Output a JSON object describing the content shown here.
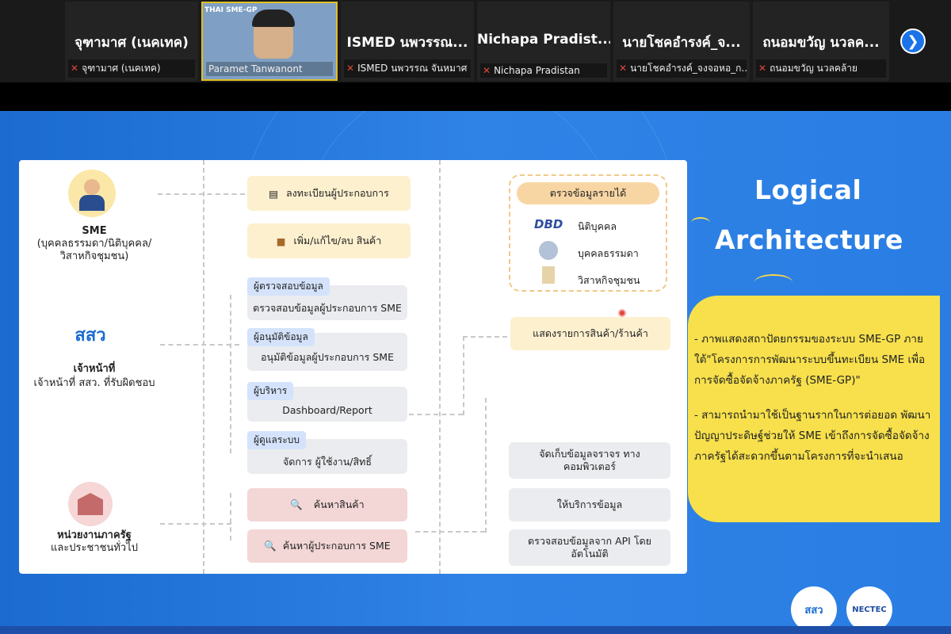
{
  "participants": [
    {
      "big": "จุฑามาศ (เนคเทค)",
      "small": "จุฑามาศ (เนคเทค)",
      "muted": true
    },
    {
      "big": "",
      "small": "Paramet Tanwanont",
      "muted": false,
      "video": true,
      "video_logo": "THAI SME-GP"
    },
    {
      "big": "ISMED นพวรรณ...",
      "small": "ISMED นพวรรณ จันหมาศ",
      "muted": true
    },
    {
      "big": "Nichapa  Pradist...",
      "small": "Nichapa Pradistan",
      "muted": true
    },
    {
      "big": "นายโชคอำรงค์_จ...",
      "small": "นายโชคอำรงค์_จงจอหอ_ก...",
      "muted": true
    },
    {
      "big": "ถนอมขวัญ นวลค...",
      "small": "ถนอมขวัญ นวลคล้าย",
      "muted": true
    }
  ],
  "next_label": "❯",
  "slide": {
    "title_line1": "Logical",
    "title_line2": "Architecture",
    "actors": {
      "sme_title": "SME",
      "sme_sub": "(บุคคลธรรมดา/นิติบุคคล/ วิสาหกิจชุมชน)",
      "staff_logo": "สสว",
      "staff_title": "เจ้าหน้าที่",
      "staff_sub": "เจ้าหน้าที่ สสว. ที่รับผิดชอบ",
      "gov_title": "หน่วยงานภาครัฐ",
      "gov_sub": "และประชาชนทั่วไป"
    },
    "boxes": {
      "register": "ลงทะเบียนผู้ประกอบการ",
      "products": "เพิ่ม/แก้ไข/ลบ สินค้า",
      "verifier_tag": "ผู้ตรวจสอบข้อมูล",
      "verifier": "ตรวจสอบข้อมูลผู้ประกอบการ SME",
      "approver_tag": "ผู้อนุมัติข้อมูล",
      "approver": "อนุมัติข้อมูลผู้ประกอบการ SME",
      "exec_tag": "ผู้บริหาร",
      "exec": "Dashboard/Report",
      "admin_tag": "ผู้ดูแลระบบ",
      "admin": "จัดการ ผู้ใช้งาน/สิทธิ์",
      "search_product": "ค้นหาสินค้า",
      "search_sme": "ค้นหาผู้ประกอบการ SME",
      "check_income": "ตรวจข้อมูลรายได้",
      "dbd_logo": "DBD",
      "juristic": "นิติบุคคล",
      "person": "บุคคลธรรมดา",
      "community": "วิสาหกิจชุมชน",
      "show_list": "แสดงรายการสินค้า/ร้านค้า",
      "store_data": "จัดเก็บข้อมูลจราจร ทางคอมพิวเตอร์",
      "provide": "ให้บริการข้อมูล",
      "api": "ตรวจสอบข้อมูลจาก API โดย อัตโนมัติ"
    },
    "note_1": "- ภาพแสดงสถาปัตยกรรมของระบบ SME-GP ภายใต้\"โครงการการพัฒนาระบบขึ้นทะเบียน SME เพื่อการจัดซื้อจัดจ้างภาครัฐ (SME-GP)\"",
    "note_2": "- สามารถนำมาใช้เป็นฐานรากในการต่อยอด พัฒนาปัญญาประดิษฐ์ช่วยให้ SME เข้าถึงการจัดซื้อจัดจ้างภาครัฐได้สะดวกขึ้นตามโครงการที่จะนำเสนอ",
    "footer_logo_1": "สสว",
    "footer_logo_2": "NECTEC"
  },
  "colors": {
    "slide_bg": "#2a7ee3",
    "note_bg": "#f7e04c",
    "mute": "#e0453b",
    "tag": "#d4e3fb"
  }
}
